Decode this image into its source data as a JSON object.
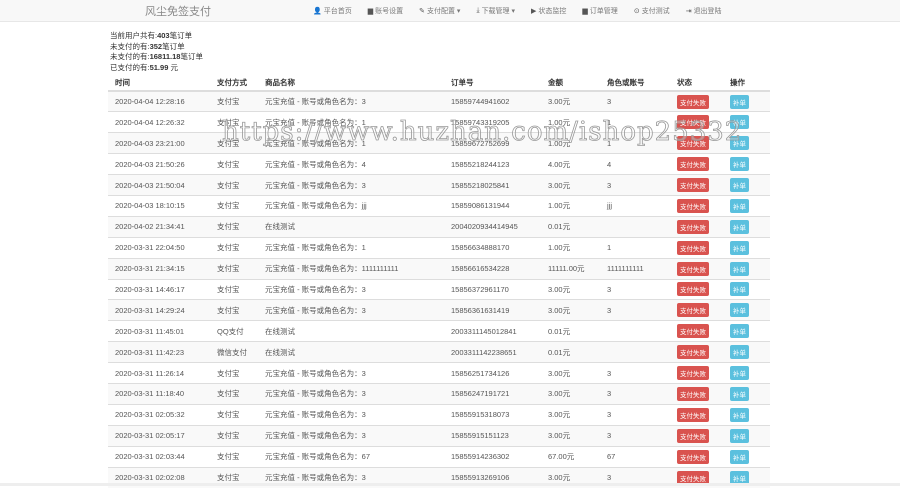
{
  "brand": "风尘免签支付",
  "nav": [
    {
      "icon": "user-icon",
      "glyph": "👤",
      "label": "平台首页"
    },
    {
      "icon": "book-icon",
      "glyph": "▆",
      "label": "账号设置"
    },
    {
      "icon": "pencil-icon",
      "glyph": "✎",
      "label": "支付配置 ▾"
    },
    {
      "icon": "download-icon",
      "glyph": "⤓",
      "label": "下载管理 ▾"
    },
    {
      "icon": "play-icon",
      "glyph": "▶",
      "label": "状态监控"
    },
    {
      "icon": "list-icon",
      "glyph": "▆",
      "label": "订单管理"
    },
    {
      "icon": "circle-dot-icon",
      "glyph": "⊙",
      "label": "支付测试"
    },
    {
      "icon": "logout-icon",
      "glyph": "⇥",
      "label": "退出登陆"
    }
  ],
  "stats": {
    "l1_pre": "当前用户共有:",
    "l1_val": "403",
    "l1_post": "笔订单",
    "l2_pre": "未支付的有:",
    "l2_val": "352",
    "l2_post": "笔订单",
    "l3_pre": "未支付的有:",
    "l3_val": "16811.18",
    "l3_post": "笔订单",
    "l4_pre": "已支付的有:",
    "l4_val": "51.99",
    "l4_post": " 元"
  },
  "headers": [
    "时间",
    "支付方式",
    "商品名称",
    "订单号",
    "金额",
    "角色或账号",
    "状态",
    "操作"
  ],
  "rows": [
    [
      "2020-04-04 12:28:16",
      "支付宝",
      "元宝充值 - 账号或角色名为：3",
      "15859744941602",
      "3.00元",
      "3"
    ],
    [
      "2020-04-04 12:26:32",
      "支付宝",
      "元宝充值 - 账号或角色名为：1",
      "15859743319205",
      "1.00元",
      "1"
    ],
    [
      "2020-04-03 23:21:00",
      "支付宝",
      "元宝充值 - 账号或角色名为：1",
      "15859672752699",
      "1.00元",
      "1"
    ],
    [
      "2020-04-03 21:50:26",
      "支付宝",
      "元宝充值 - 账号或角色名为：4",
      "15855218244123",
      "4.00元",
      "4"
    ],
    [
      "2020-04-03 21:50:04",
      "支付宝",
      "元宝充值 - 账号或角色名为：3",
      "15855218025841",
      "3.00元",
      "3"
    ],
    [
      "2020-04-03 18:10:15",
      "支付宝",
      "元宝充值 - 账号或角色名为：jjj",
      "15859086131944",
      "1.00元",
      "jjj"
    ],
    [
      "2020-04-02 21:34:41",
      "支付宝",
      "在线测试",
      "2004020934414945",
      "0.01元",
      ""
    ],
    [
      "2020-03-31 22:04:50",
      "支付宝",
      "元宝充值 - 账号或角色名为：1",
      "15856634888170",
      "1.00元",
      "1"
    ],
    [
      "2020-03-31 21:34:15",
      "支付宝",
      "元宝充值 - 账号或角色名为：1111111111",
      "15856616534228",
      "11111.00元",
      "1111111111"
    ],
    [
      "2020-03-31 14:46:17",
      "支付宝",
      "元宝充值 - 账号或角色名为：3",
      "15856372961170",
      "3.00元",
      "3"
    ],
    [
      "2020-03-31 14:29:24",
      "支付宝",
      "元宝充值 - 账号或角色名为：3",
      "15856361631419",
      "3.00元",
      "3"
    ],
    [
      "2020-03-31 11:45:01",
      "QQ支付",
      "在线测试",
      "2003311145012841",
      "0.01元",
      ""
    ],
    [
      "2020-03-31 11:42:23",
      "微信支付",
      "在线测试",
      "2003311142238651",
      "0.01元",
      ""
    ],
    [
      "2020-03-31 11:26:14",
      "支付宝",
      "元宝充值 - 账号或角色名为：3",
      "15856251734126",
      "3.00元",
      "3"
    ],
    [
      "2020-03-31 11:18:40",
      "支付宝",
      "元宝充值 - 账号或角色名为：3",
      "15856247191721",
      "3.00元",
      "3"
    ],
    [
      "2020-03-31 02:05:32",
      "支付宝",
      "元宝充值 - 账号或角色名为：3",
      "15855915318073",
      "3.00元",
      "3"
    ],
    [
      "2020-03-31 02:05:17",
      "支付宝",
      "元宝充值 - 账号或角色名为：3",
      "15855915151123",
      "3.00元",
      "3"
    ],
    [
      "2020-03-31 02:03:44",
      "支付宝",
      "元宝充值 - 账号或角色名为：67",
      "15855914236302",
      "67.00元",
      "67"
    ],
    [
      "2020-03-31 02:02:08",
      "支付宝",
      "元宝充值 - 账号或角色名为：3",
      "15855913269106",
      "3.00元",
      "3"
    ]
  ],
  "status_label": "支付失败",
  "action_label": "补单",
  "watermark": "https://www.huzhan.com/ishop25332",
  "colors": {
    "danger": "#d9534f",
    "info": "#5bc0de"
  }
}
